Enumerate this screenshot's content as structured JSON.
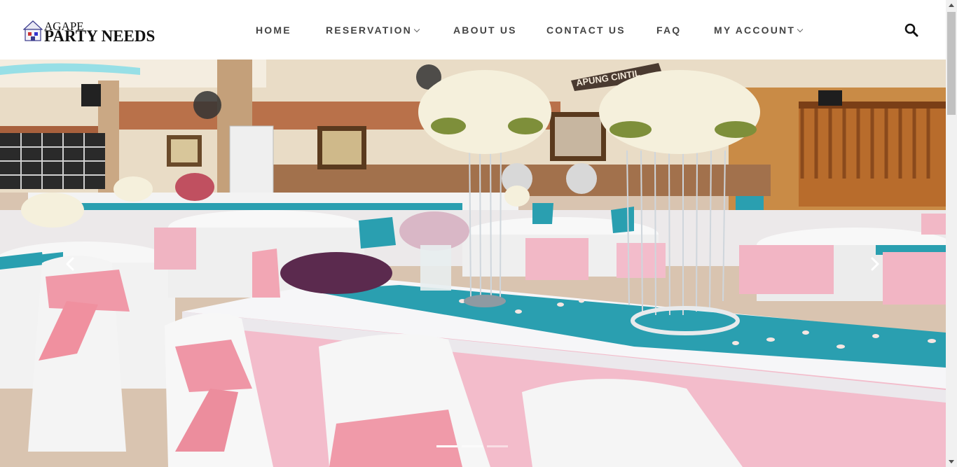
{
  "brand": {
    "small": "AGAPE",
    "big": "PARTY NEEDS",
    "logo_icon": "house-logo-icon"
  },
  "nav": {
    "items": [
      {
        "label": "HOME",
        "has_dropdown": false
      },
      {
        "label": "RESERVATION",
        "has_dropdown": true
      },
      {
        "label": "ABOUT US",
        "has_dropdown": false
      },
      {
        "label": "CONTACT US",
        "has_dropdown": false
      },
      {
        "label": "FAQ",
        "has_dropdown": false
      },
      {
        "label": "MY ACCOUNT",
        "has_dropdown": true
      }
    ],
    "search_icon": "search-icon"
  },
  "carousel": {
    "slide_count": 3,
    "active_slide": 1,
    "prev_icon": "chevron-left-icon",
    "next_icon": "chevron-right-icon",
    "banner_text": "APUNG CINTIL"
  },
  "colors": {
    "nav_text": "#444444",
    "tablecloth_pink": "#f2b8c6",
    "runner_teal": "#2a9fb0"
  }
}
